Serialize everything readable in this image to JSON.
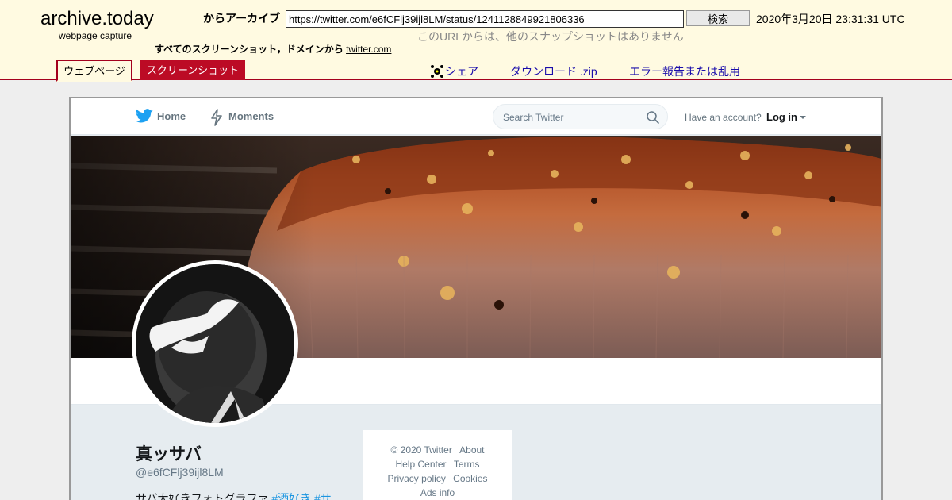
{
  "archive": {
    "logo": "archive.today",
    "logo_sub": "webpage capture",
    "archive_label": "からアーカイブ",
    "url": "https://twitter.com/e6fCFlj39ijl8LM/status/1241128849921806336",
    "search_button": "検索",
    "timestamp": "2020年3月20日 23:31:31 UTC",
    "no_snapshots": "このURLからは、他のスナップショットはありません",
    "all_screenshots_prefix": "すべてのスクリーンショット，ドメインから",
    "all_screenshots_domain": "twitter.com",
    "tabs": [
      {
        "label": "ウェブページ",
        "active": true
      },
      {
        "label": "スクリーンショット",
        "active": false
      }
    ],
    "actions": {
      "share": "シェア",
      "download": "ダウンロード .zip",
      "report": "エラー報告または乱用"
    },
    "colors": {
      "bg": "#fffae1",
      "accent": "#a4001e",
      "tab_red": "#bc0b25",
      "link": "#1a0dab"
    }
  },
  "twitter": {
    "nav": {
      "home": "Home",
      "moments": "Moments",
      "search_placeholder": "Search Twitter",
      "have_account": "Have an account?",
      "login": "Log in"
    },
    "profile": {
      "name": "真ッサバ",
      "handle": "@e6fCFlj39ijl8LM",
      "bio_text": "サバ大好きフォトグラファ",
      "bio_tags": "#酒好き #サ"
    },
    "footer": {
      "copyright": "© 2020 Twitter",
      "about": "About",
      "help": "Help Center",
      "terms": "Terms",
      "privacy": "Privacy policy",
      "cookies": "Cookies",
      "ads": "Ads info"
    },
    "colors": {
      "brand": "#1da1f2",
      "tag": "#1b95e0",
      "text": "#14171a",
      "muted": "#657786"
    }
  }
}
